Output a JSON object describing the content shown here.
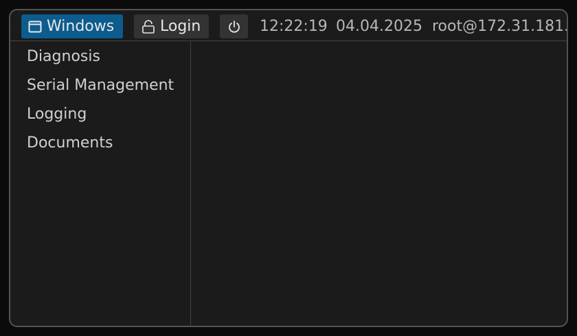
{
  "topbar": {
    "windows_label": "Windows",
    "windows_icon": "window-icon",
    "login_label": "Login",
    "login_icon": "unlock-icon",
    "power_icon": "power-icon",
    "time": "12:22:19",
    "date": "04.04.2025",
    "user_host": "root@172.31.181."
  },
  "sidebar": {
    "items": [
      {
        "label": "Diagnosis"
      },
      {
        "label": "Serial Management"
      },
      {
        "label": "Logging"
      },
      {
        "label": "Documents"
      }
    ]
  },
  "colors": {
    "accent": "#0c5c8e",
    "panel_bg": "#1b1b1b",
    "button_bg": "#333333",
    "border": "#4e5654"
  }
}
